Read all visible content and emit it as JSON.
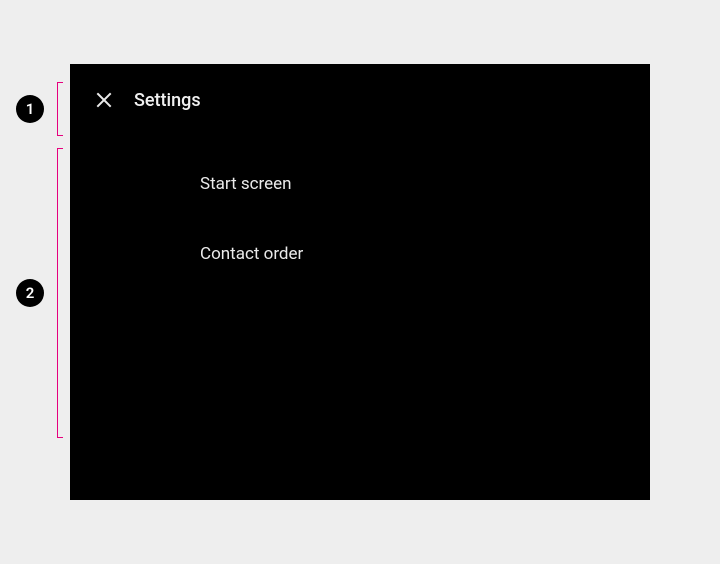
{
  "annotations": {
    "marker1": "1",
    "marker2": "2"
  },
  "header": {
    "title": "Settings"
  },
  "menu": {
    "items": [
      {
        "label": "Start screen"
      },
      {
        "label": "Contact order"
      }
    ]
  },
  "icons": {
    "close": "close-icon"
  }
}
